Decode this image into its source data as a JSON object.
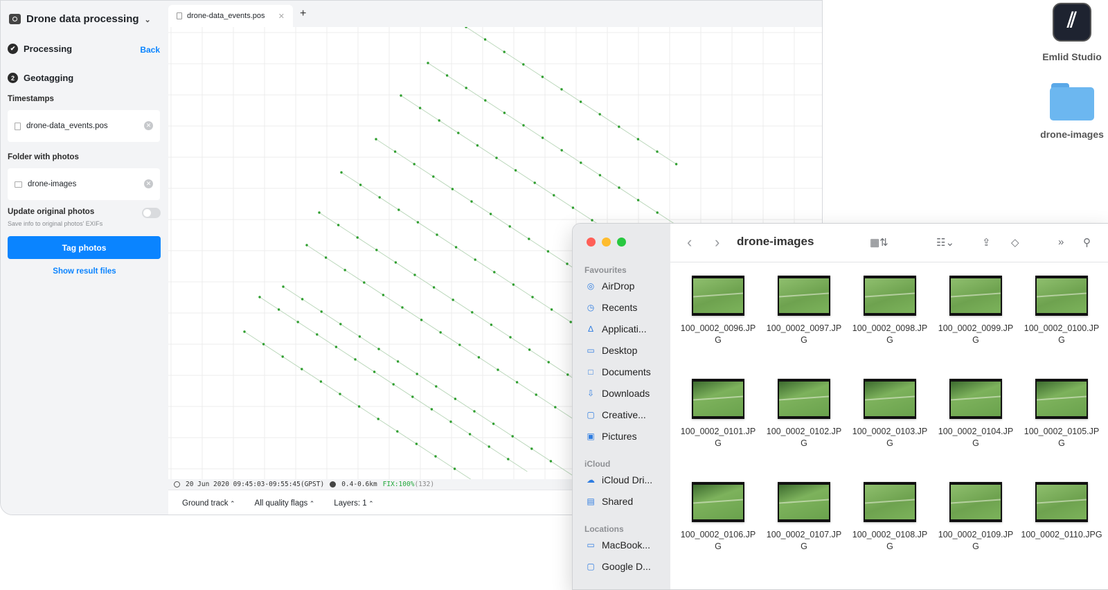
{
  "studio": {
    "project_title": "Drone data processing",
    "steps": [
      {
        "badge": "✔",
        "label": "Processing",
        "action": "Back"
      },
      {
        "badge": "2",
        "label": "Geotagging"
      }
    ],
    "timestamps_label": "Timestamps",
    "timestamps_file": "drone-data_events.pos",
    "folder_label": "Folder with photos",
    "folder_value": "drone-images",
    "update_label": "Update original photos",
    "update_hint": "Save info to original photos' EXIFs",
    "update_enabled": false,
    "tag_button": "Tag photos",
    "show_results": "Show result files",
    "tab_name": "drone-data_events.pos",
    "tab_add": "+",
    "status": {
      "time": "20 Jun 2020 09:45:03-09:55:45(GPST)",
      "range": "0.4-0.6km",
      "fix": "FIX:100%",
      "count": "(132)"
    },
    "bottom": [
      "Ground track",
      "All quality flags",
      "Layers: 1"
    ],
    "map_colors": {
      "point": "#2e9e2e",
      "track": "#bcd8bc",
      "grid": "#ececec"
    }
  },
  "desktop": [
    {
      "label": "Emlid Studio",
      "icon": "emlid-studio-app-icon"
    },
    {
      "label": "drone-images",
      "icon": "folder-icon"
    }
  ],
  "finder": {
    "title": "drone-images",
    "sections": [
      {
        "title": "Favourites",
        "items": [
          {
            "label": "AirDrop",
            "icon": "airdrop-icon"
          },
          {
            "label": "Recents",
            "icon": "clock-icon"
          },
          {
            "label": "Applicati...",
            "icon": "applications-icon"
          },
          {
            "label": "Desktop",
            "icon": "desktop-icon"
          },
          {
            "label": "Documents",
            "icon": "document-icon"
          },
          {
            "label": "Downloads",
            "icon": "download-icon"
          },
          {
            "label": "Creative...",
            "icon": "file-icon"
          },
          {
            "label": "Pictures",
            "icon": "pictures-icon"
          }
        ]
      },
      {
        "title": "iCloud",
        "items": [
          {
            "label": "iCloud Dri...",
            "icon": "cloud-icon"
          },
          {
            "label": "Shared",
            "icon": "shared-folder-icon"
          }
        ]
      },
      {
        "title": "Locations",
        "items": [
          {
            "label": "MacBook...",
            "icon": "laptop-icon"
          },
          {
            "label": "Google D...",
            "icon": "drive-icon"
          }
        ]
      }
    ],
    "files": [
      "100_0002_0096.JPG",
      "100_0002_0097.JPG",
      "100_0002_0098.JPG",
      "100_0002_0099.JPG",
      "100_0002_0100.JPG",
      "100_0002_0101.JPG",
      "100_0002_0102.JPG",
      "100_0002_0103.JPG",
      "100_0002_0104.JPG",
      "100_0002_0105.JPG",
      "100_0002_0106.JPG",
      "100_0002_0107.JPG",
      "100_0002_0108.JPG",
      "100_0002_0109.JPG",
      "100_0002_0110.JPG"
    ]
  }
}
